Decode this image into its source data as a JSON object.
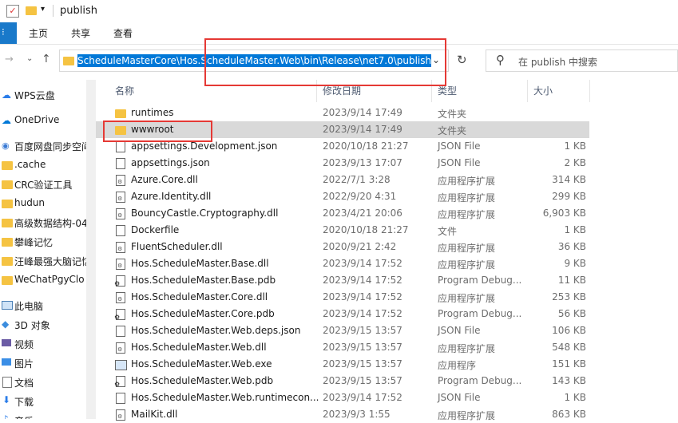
{
  "title": "publish",
  "ribbon": {
    "tabs": [
      "主页",
      "共享",
      "查看"
    ]
  },
  "address": {
    "path": "ScheduleMasterCore\\Hos.ScheduleMaster.Web\\bin\\Release\\net7.0\\publish"
  },
  "search": {
    "placeholder": "在 publish 中搜索"
  },
  "sidebar": [
    {
      "label": "WPS云盘",
      "icon": "cloud-icon"
    },
    {
      "label": "OneDrive",
      "icon": "onedrive-icon"
    },
    {
      "label": "百度网盘同步空间",
      "icon": "baidu-icon"
    },
    {
      "label": ".cache",
      "icon": "folder-icon"
    },
    {
      "label": "CRC验证工具",
      "icon": "folder-icon"
    },
    {
      "label": "hudun",
      "icon": "folder-icon"
    },
    {
      "label": "高级数据结构-04",
      "icon": "folder-icon"
    },
    {
      "label": "攀峰记忆",
      "icon": "folder-icon"
    },
    {
      "label": "汪峰最强大脑记忆",
      "icon": "folder-icon"
    },
    {
      "label": "WeChatPgyClo",
      "icon": "folder-icon"
    },
    {
      "label": "此电脑",
      "icon": "pc-icon"
    },
    {
      "label": "3D 对象",
      "icon": "3d-icon"
    },
    {
      "label": "视频",
      "icon": "video-icon"
    },
    {
      "label": "图片",
      "icon": "picture-icon"
    },
    {
      "label": "文档",
      "icon": "document-icon"
    },
    {
      "label": "下载",
      "icon": "download-icon"
    },
    {
      "label": "音乐",
      "icon": "music-icon"
    }
  ],
  "columns": {
    "name": "名称",
    "date": "修改日期",
    "type": "类型",
    "size": "大小"
  },
  "files": [
    {
      "name": "runtimes",
      "date": "2023/9/14 17:49",
      "type": "文件夹",
      "size": "",
      "icon": "folder-icon"
    },
    {
      "name": "wwwroot",
      "date": "2023/9/14 17:49",
      "type": "文件夹",
      "size": "",
      "icon": "folder-icon",
      "selected": true
    },
    {
      "name": "appsettings.Development.json",
      "date": "2020/10/18 21:27",
      "type": "JSON File",
      "size": "1 KB",
      "icon": "json-icon"
    },
    {
      "name": "appsettings.json",
      "date": "2023/9/13 17:07",
      "type": "JSON File",
      "size": "2 KB",
      "icon": "json-icon"
    },
    {
      "name": "Azure.Core.dll",
      "date": "2022/7/1 3:28",
      "type": "应用程序扩展",
      "size": "314 KB",
      "icon": "dll-icon"
    },
    {
      "name": "Azure.Identity.dll",
      "date": "2022/9/20 4:31",
      "type": "应用程序扩展",
      "size": "299 KB",
      "icon": "dll-icon"
    },
    {
      "name": "BouncyCastle.Cryptography.dll",
      "date": "2023/4/21 20:06",
      "type": "应用程序扩展",
      "size": "6,903 KB",
      "icon": "dll-icon"
    },
    {
      "name": "Dockerfile",
      "date": "2020/10/18 21:27",
      "type": "文件",
      "size": "1 KB",
      "icon": "file-icon"
    },
    {
      "name": "FluentScheduler.dll",
      "date": "2020/9/21 2:42",
      "type": "应用程序扩展",
      "size": "36 KB",
      "icon": "dll-icon"
    },
    {
      "name": "Hos.ScheduleMaster.Base.dll",
      "date": "2023/9/14 17:52",
      "type": "应用程序扩展",
      "size": "9 KB",
      "icon": "dll-icon"
    },
    {
      "name": "Hos.ScheduleMaster.Base.pdb",
      "date": "2023/9/14 17:52",
      "type": "Program Debug...",
      "size": "11 KB",
      "icon": "pdb-icon"
    },
    {
      "name": "Hos.ScheduleMaster.Core.dll",
      "date": "2023/9/14 17:52",
      "type": "应用程序扩展",
      "size": "253 KB",
      "icon": "dll-icon"
    },
    {
      "name": "Hos.ScheduleMaster.Core.pdb",
      "date": "2023/9/14 17:52",
      "type": "Program Debug...",
      "size": "56 KB",
      "icon": "pdb-icon"
    },
    {
      "name": "Hos.ScheduleMaster.Web.deps.json",
      "date": "2023/9/15 13:57",
      "type": "JSON File",
      "size": "106 KB",
      "icon": "json-icon"
    },
    {
      "name": "Hos.ScheduleMaster.Web.dll",
      "date": "2023/9/15 13:57",
      "type": "应用程序扩展",
      "size": "548 KB",
      "icon": "dll-icon"
    },
    {
      "name": "Hos.ScheduleMaster.Web.exe",
      "date": "2023/9/15 13:57",
      "type": "应用程序",
      "size": "151 KB",
      "icon": "exe-icon"
    },
    {
      "name": "Hos.ScheduleMaster.Web.pdb",
      "date": "2023/9/15 13:57",
      "type": "Program Debug...",
      "size": "143 KB",
      "icon": "pdb-icon"
    },
    {
      "name": "Hos.ScheduleMaster.Web.runtimecon...",
      "date": "2023/9/14 17:52",
      "type": "JSON File",
      "size": "1 KB",
      "icon": "json-icon"
    },
    {
      "name": "MailKit.dll",
      "date": "2023/9/3 1:55",
      "type": "应用程序扩展",
      "size": "863 KB",
      "icon": "dll-icon"
    }
  ],
  "colors": {
    "accent": "#0078d7",
    "highlight": "#e53935",
    "folder": "#f5c342"
  }
}
